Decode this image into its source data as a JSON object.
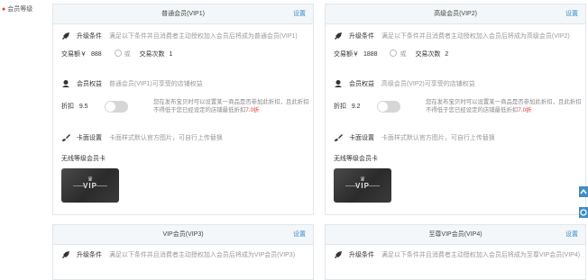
{
  "sidebar": {
    "title": "会员等级"
  },
  "levels": [
    {
      "title": "普通会员(VIP1)",
      "settings": "设置",
      "upgrade": {
        "title": "升级条件",
        "desc": "满足以下条件并且消费者主动授权加入会员后将成为普通会员(VIP1)"
      },
      "amount_label": "交易额￥",
      "amount_value": "888",
      "or_label": "或",
      "count_label": "交易次数",
      "count_value": "1",
      "rights": {
        "title": "会员权益",
        "desc": "普通会员(VIP1)可享受的店铺权益"
      },
      "discount_label": "折扣",
      "discount_value": "9.5",
      "tip_line1": "您在发布宝贝时可以设置某一商品是否参加此折扣，且此折扣",
      "tip_line2": "不得低于您已经设定的店铺最低折扣",
      "tip_red": "7.0折",
      "cardset": {
        "title": "卡面设置",
        "desc": "卡面样式默认官方图片，可自行上传替换"
      },
      "card_label": "无线等级会员卡",
      "card_text": "VIP"
    },
    {
      "title": "高级会员(VIP2)",
      "settings": "设置",
      "upgrade": {
        "title": "升级条件",
        "desc": "满足以下条件并且消费者主动授权加入会员后将成为高级会员(VIP2)"
      },
      "amount_label": "交易额￥",
      "amount_value": "1888",
      "or_label": "或",
      "count_label": "交易次数",
      "count_value": "2",
      "rights": {
        "title": "会员权益",
        "desc": "高级会员(VIP2)可享受的店铺权益"
      },
      "discount_label": "折扣",
      "discount_value": "9.2",
      "tip_line1": "您在发布宝贝时可以设置某一商品是否参加此折扣，且此折扣",
      "tip_line2": "不得低于您已经设定的店铺最低折扣",
      "tip_red": "7.0折",
      "cardset": {
        "title": "卡面设置",
        "desc": "卡面样式默认官方图片，可自行上传替换"
      },
      "card_label": "无线等级会员卡",
      "card_text": "VIP"
    },
    {
      "title": "VIP会员(VIP3)",
      "settings": "设置",
      "upgrade": {
        "title": "升级条件",
        "desc": "满足以下条件并且消费者主动授权加入会员后将成为VIP会员(VIP3)"
      }
    },
    {
      "title": "至尊VIP会员(VIP4)",
      "settings": "设置",
      "upgrade": {
        "title": "升级条件",
        "desc": "满足以下条件并且消费者主动授权加入会员后将成为至尊VIP会员(VIP4)"
      }
    }
  ],
  "colors": {
    "accent": "#3c8ec8",
    "red": "#e4393c",
    "header_bg": "#f3f7f9"
  }
}
